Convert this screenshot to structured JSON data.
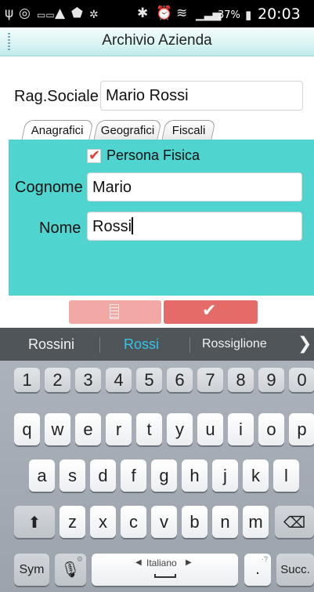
{
  "status_bar": {
    "icons": [
      "usb-icon",
      "whatsapp-icon",
      "voicemail-icon",
      "warning-icon",
      "shield-icon",
      "bug-icon",
      "bluetooth-icon",
      "alarm-icon",
      "wifi-icon",
      "signal-icon",
      "battery-icon"
    ],
    "battery": "37%",
    "time": "20:03"
  },
  "title_bar": {
    "title": "Archivio Azienda"
  },
  "form": {
    "rag_sociale_label": "Rag.Sociale",
    "rag_sociale_value": "Mario Rossi",
    "tabs": [
      {
        "label": "Anagrafici",
        "active": true
      },
      {
        "label": "Geografici",
        "active": false
      },
      {
        "label": "Fiscali",
        "active": false
      }
    ],
    "persona_fisica_label": "Persona Fisica",
    "persona_fisica_checked": true,
    "cognome_label": "Cognome",
    "cognome_value": "Mario",
    "nome_label": "Nome",
    "nome_value": "Rossi"
  },
  "actions": {
    "list_icon": "list-icon",
    "confirm_icon": "check-icon"
  },
  "colors": {
    "panel": "#4fd4cf",
    "accent_red": "#e56b68",
    "accent_red_light": "#f2a8a5"
  },
  "keyboard": {
    "suggestions": [
      "Rossini",
      "Rossi",
      "Rossiglione"
    ],
    "more_icon": "chevron-right-icon",
    "numbers": [
      "1",
      "2",
      "3",
      "4",
      "5",
      "6",
      "7",
      "8",
      "9",
      "0"
    ],
    "row1": [
      "q",
      "w",
      "e",
      "r",
      "t",
      "y",
      "u",
      "i",
      "o",
      "p"
    ],
    "row2": [
      "a",
      "s",
      "d",
      "f",
      "g",
      "h",
      "j",
      "k",
      "l"
    ],
    "row3": [
      "z",
      "x",
      "c",
      "v",
      "b",
      "n",
      "m"
    ],
    "sym_label": "Sym",
    "language_label": "Italiano",
    "dot_label": ".",
    "dot_hint": "·?",
    "enter_label": "Succ.",
    "shift_icon": "shift-icon",
    "backspace_icon": "backspace-icon",
    "mic_icon": "microphone-icon"
  }
}
